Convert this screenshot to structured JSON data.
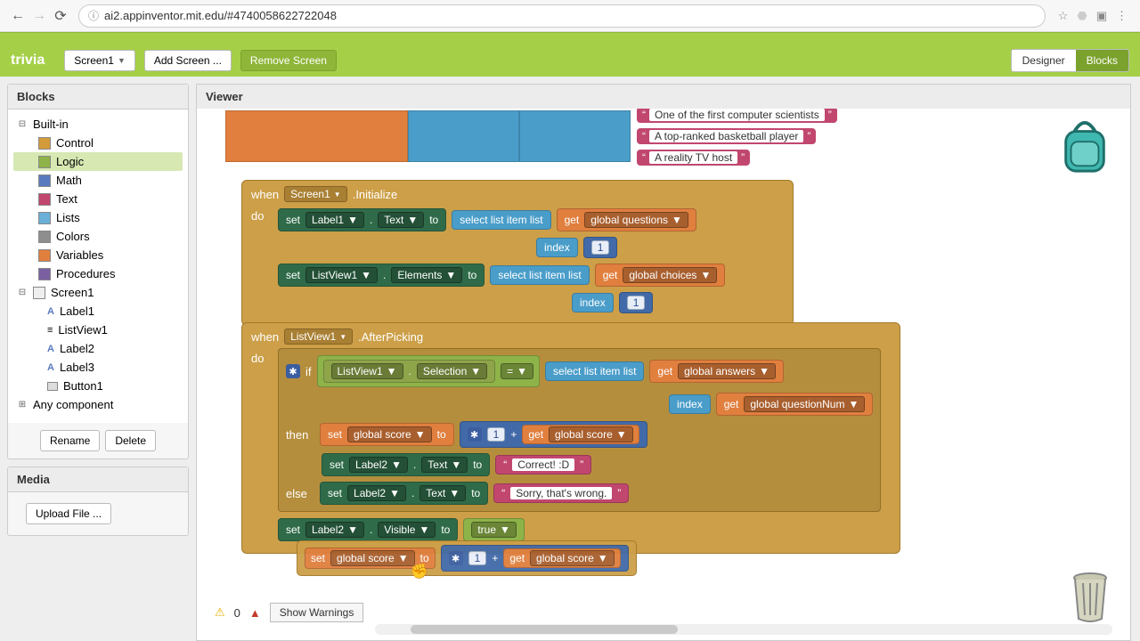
{
  "browser": {
    "url": "ai2.appinventor.mit.edu/#4740058622722048"
  },
  "project": "trivia",
  "screens": {
    "selected": "Screen1",
    "add": "Add Screen ...",
    "remove": "Remove Screen"
  },
  "view_toggle": {
    "designer": "Designer",
    "blocks": "Blocks"
  },
  "panels": {
    "blocks": "Blocks",
    "viewer": "Viewer",
    "media": "Media"
  },
  "builtins": [
    "Built-in",
    "Control",
    "Logic",
    "Math",
    "Text",
    "Lists",
    "Colors",
    "Variables",
    "Procedures"
  ],
  "screen_tree": {
    "root": "Screen1",
    "items": [
      "Label1",
      "ListView1",
      "Label2",
      "Label3",
      "Button1"
    ],
    "any": "Any component"
  },
  "buttons": {
    "rename": "Rename",
    "delete": "Delete",
    "upload": "Upload File ..."
  },
  "top_strings": [
    "One of the first computer scientists",
    "A top-ranked basketball player",
    "A reality TV host"
  ],
  "evt_init": {
    "when": "when",
    "component": "Screen1",
    "method": ".Initialize",
    "do": "do",
    "set": "set",
    "label1": "Label1",
    "text": "Text",
    "to": "to",
    "select": "select list item  list",
    "get": "get",
    "gq": "global questions",
    "index": "index",
    "one": "1",
    "lv": "ListView1",
    "elements": "Elements",
    "gc": "global choices"
  },
  "evt_pick": {
    "component": "ListView1",
    "method": ".AfterPicking",
    "if": "if",
    "then": "then",
    "else": "else",
    "selection": "Selection",
    "eq": "=",
    "ga": "global answers",
    "gqn": "global questionNum",
    "set": "set",
    "gs": "global score",
    "to": "to",
    "plus": "+",
    "get": "get",
    "one": "1",
    "label2": "Label2",
    "text": "Text",
    "correct": "Correct! :D",
    "wrong": "Sorry, that's wrong.",
    "visible": "Visible",
    "true": "true"
  },
  "warnings": {
    "count": "0",
    "err_count": "",
    "show": "Show Warnings"
  }
}
